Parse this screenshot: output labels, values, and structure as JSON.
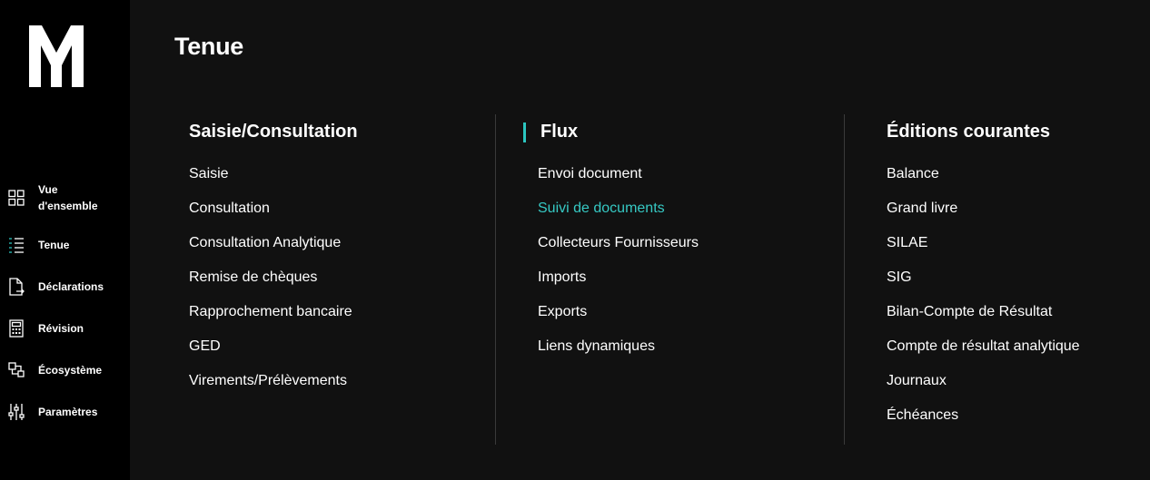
{
  "menu": {
    "title": "Tenue",
    "columns": [
      {
        "heading": "Saisie/Consultation",
        "links": [
          "Saisie",
          "Consultation",
          "Consultation Analytique",
          "Remise de chèques",
          "Rapprochement bancaire",
          "GED",
          "Virements/Prélèvements"
        ]
      },
      {
        "heading": "Flux",
        "active_link": "Suivi de documents",
        "links": [
          "Envoi document",
          "Suivi de documents",
          "Collecteurs Fournisseurs",
          "Imports",
          "Exports",
          "Liens dynamiques"
        ]
      },
      {
        "heading": "Éditions courantes",
        "links": [
          "Balance",
          "Grand livre",
          "SILAE",
          "SIG",
          "Bilan-Compte de Résultat",
          "Compte de résultat analytique",
          "Journaux",
          "Échéances"
        ]
      }
    ]
  },
  "sidebar": {
    "logo_icon": "m-logo-icon",
    "items": [
      {
        "label_line1": "Vue",
        "label_line2": "d'ensemble",
        "icon": "grid-icon"
      },
      {
        "label": "Tenue",
        "icon": "list-icon"
      },
      {
        "label": "Déclarations",
        "icon": "document-arrow-icon"
      },
      {
        "label": "Révision",
        "icon": "calculator-icon"
      },
      {
        "label": "Écosystème",
        "icon": "ecosystem-icon"
      },
      {
        "label": "Paramètres",
        "icon": "sliders-icon"
      }
    ]
  },
  "colors": {
    "accent": "#2bc6c0",
    "active_link": "#36c9c4",
    "background": "#000000",
    "overlay": "#101010"
  }
}
